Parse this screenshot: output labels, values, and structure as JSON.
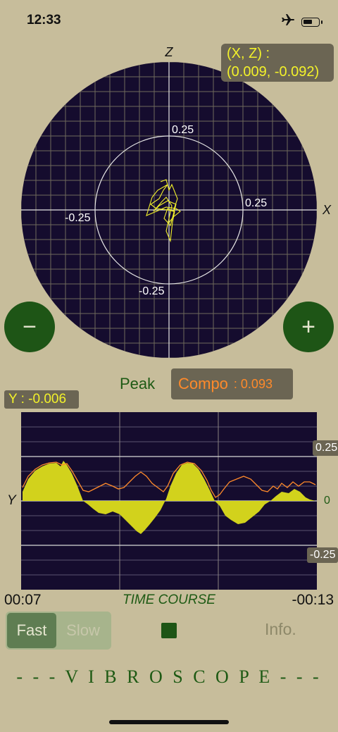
{
  "status": {
    "time": "12:33"
  },
  "polar": {
    "axis_x_label": "X",
    "axis_z_label": "Z",
    "tick_top": "0.25",
    "tick_right": "0.25",
    "tick_left": "-0.25",
    "tick_bottom": "-0.25"
  },
  "xz_readout": {
    "line1": "(X, Z)  :",
    "line2": "(0.009, -0.092)"
  },
  "zoom": {
    "minus": "−",
    "plus": "+"
  },
  "peak": {
    "label": "Peak",
    "compo_label": "Compo",
    "compo_value": ": 0.093"
  },
  "y_readout": "Y : -0.006",
  "timecourse": {
    "axis_y_label": "Y",
    "tick_top": "0.25",
    "tick_zero": "0",
    "tick_bottom": "-0.25",
    "title": "TIME COURSE",
    "start": "00:07",
    "end": "-00:13"
  },
  "controls": {
    "fast": "Fast",
    "slow": "Slow",
    "info": "Info."
  },
  "brand": "- - -  V I B R O S C O P E  - - -",
  "colors": {
    "trace": "#f3f22a",
    "compo": "#ff8a2a",
    "plot_bg": "#150c2e",
    "button": "#1e5516"
  }
}
